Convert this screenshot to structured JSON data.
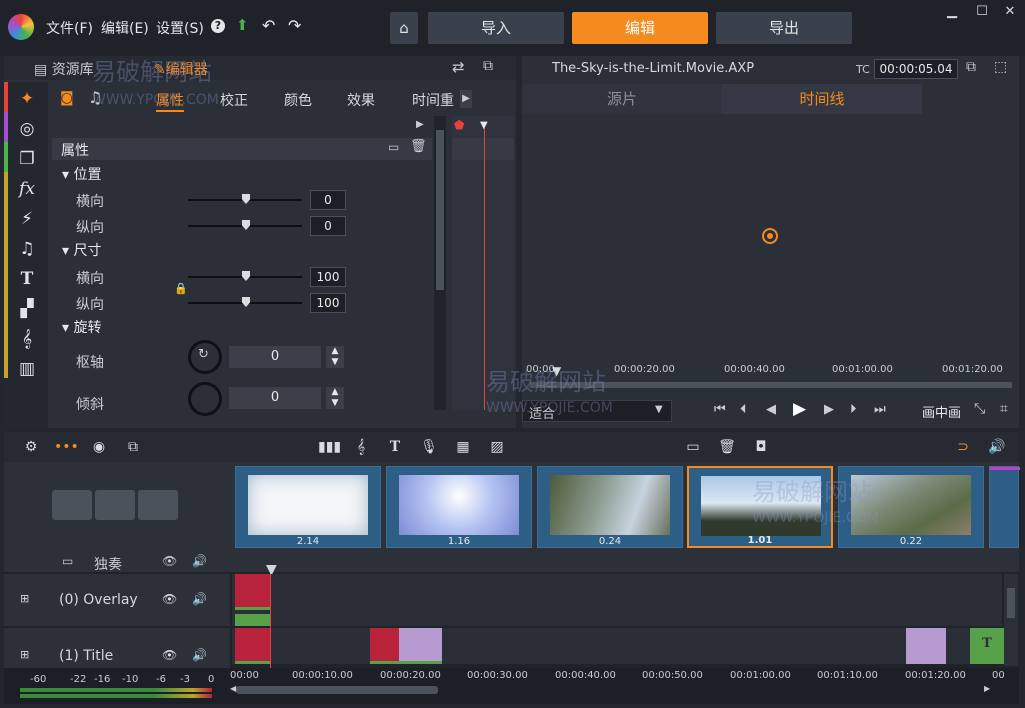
{
  "menu": {
    "file": "文件(F)",
    "edit": "编辑(E)",
    "settings": "设置(S)"
  },
  "top_tabs": {
    "import": "导入",
    "edit": "编辑",
    "export": "导出"
  },
  "left_header": {
    "library": "资源库",
    "editor": "编辑器"
  },
  "editor_tabs": {
    "properties": "属性",
    "correction": "校正",
    "color": "颜色",
    "effects": "效果",
    "timewarp": "时间重"
  },
  "props": {
    "header": "属性",
    "position": "位置",
    "horizontal": "横向",
    "vertical": "纵向",
    "pos_h_value": "0",
    "pos_v_value": "0",
    "size": "尺寸",
    "size_h_value": "100",
    "size_v_value": "100",
    "rotation": "旋转",
    "axis": "枢轴",
    "axis_value": "0",
    "tilt": "倾斜",
    "tilt_value": "0"
  },
  "preview": {
    "filename": "The-Sky-is-the-Limit.Movie.AXP",
    "tc_label": "TC",
    "timecode": "00:00:05.04",
    "tab_source": "源片",
    "tab_timeline": "时间线",
    "ruler": [
      "00:00",
      "00:00:20.00",
      "00:00:40.00",
      "00:01:00.00",
      "00:01:20.00"
    ],
    "fit": "适合",
    "pip": "画中画"
  },
  "storyboard": {
    "durations": [
      "2.14",
      "1.16",
      "0.24",
      "1.01",
      "0.22"
    ]
  },
  "tracks": {
    "solo": "独奏",
    "overlay": "(0) Overlay",
    "title": "(1) Title"
  },
  "timeline_ruler": [
    "00:00",
    "00:00:10.00",
    "00:00:20.00",
    "00:00:30.00",
    "00:00:40.00",
    "00:00:50.00",
    "00:01:00.00",
    "00:01:10.00",
    "00:01:20.00",
    "00"
  ],
  "vu_scale": [
    "-60",
    "-22",
    "-16",
    "-10",
    "-6",
    "-3",
    "0"
  ],
  "watermark": {
    "cn": "易破解网站",
    "url": "WWW.YPOJIE.COM"
  },
  "colors": {
    "accent": "#f58a1f",
    "panel": "#2a2f38",
    "clip_red": "#b8223a",
    "clip_purple": "#b79bd0",
    "clip_green": "#58a04a"
  }
}
